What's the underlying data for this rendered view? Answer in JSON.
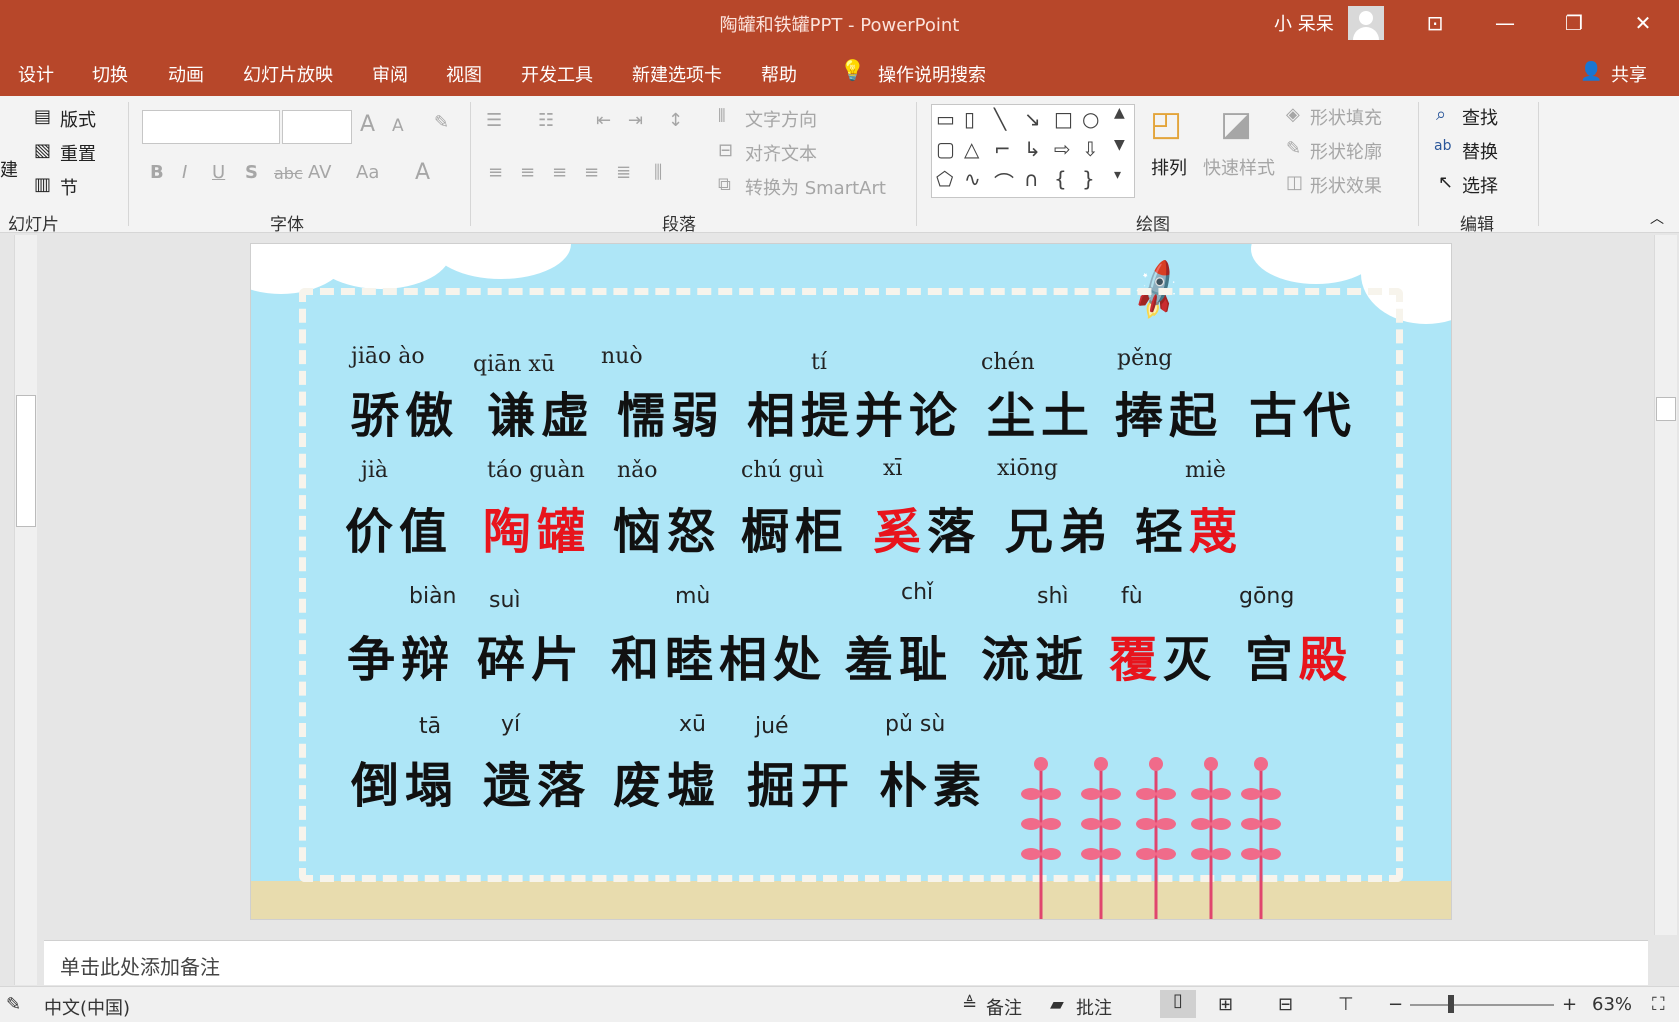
{
  "titlebar": {
    "title": "陶罐和铁罐PPT  -  PowerPoint",
    "user": "小 呆呆",
    "buttons": [
      "ribbon-display",
      "minimize",
      "restore",
      "close"
    ]
  },
  "menu": {
    "tabs": [
      "设计",
      "切换",
      "动画",
      "幻灯片放映",
      "审阅",
      "视图",
      "开发工具",
      "新建选项卡",
      "帮助"
    ],
    "search": "操作说明搜索",
    "share": "共享"
  },
  "ribbon": {
    "slides_group": {
      "layout": "版式",
      "reset": "重置",
      "section": "节",
      "new_partial": "建",
      "label": "幻灯片"
    },
    "font_group": {
      "label": "字体",
      "bold": "B",
      "italic": "I",
      "underline": "U",
      "shadow": "S",
      "strike": "abc",
      "spacing": "AV",
      "case": "Aa",
      "color": "A",
      "grow": "A",
      "shrink": "A"
    },
    "paragraph_group": {
      "label": "段落",
      "text_direction": "文字方向",
      "align_text": "对齐文本",
      "smartart": "转换为 SmartArt"
    },
    "drawing_group": {
      "label": "绘图",
      "arrange": "排列",
      "quick_styles": "快速样式",
      "fill": "形状填充",
      "outline": "形状轮廓",
      "effects": "形状效果"
    },
    "editing_group": {
      "label": "编辑",
      "find": "查找",
      "replace": "替换",
      "select": "选择"
    }
  },
  "slide": {
    "rows": [
      {
        "pinyin": [
          "jiāo  ào",
          "qiān  xū",
          "nuò",
          "tí",
          "chén",
          "pěng"
        ],
        "words": [
          {
            "pre": "骄傲",
            "red": "",
            "post": ""
          },
          {
            "pre": "谦虚",
            "red": "",
            "post": ""
          },
          {
            "pre": "懦弱",
            "red": "",
            "post": ""
          },
          {
            "pre": "相提并论",
            "red": "",
            "post": ""
          },
          {
            "pre": "尘土",
            "red": "",
            "post": ""
          },
          {
            "pre": "捧起",
            "red": "",
            "post": ""
          },
          {
            "pre": "古代",
            "red": "",
            "post": ""
          }
        ]
      },
      {
        "pinyin": [
          "jià",
          "táo guàn",
          "nǎo",
          "chú  guì",
          "xī",
          "xiōng",
          "miè"
        ],
        "words": [
          {
            "pre": "价值",
            "red": "",
            "post": ""
          },
          {
            "pre": "",
            "red": "陶罐",
            "post": ""
          },
          {
            "pre": "恼怒",
            "red": "",
            "post": ""
          },
          {
            "pre": "橱柜",
            "red": "",
            "post": ""
          },
          {
            "pre": "",
            "red": "奚",
            "post": "落"
          },
          {
            "pre": "兄弟",
            "red": "",
            "post": ""
          },
          {
            "pre": "轻",
            "red": "蔑",
            "post": ""
          }
        ]
      },
      {
        "pinyin": [
          "biàn",
          "suì",
          "mù",
          "chǐ",
          "shì",
          "fù",
          "gōng"
        ],
        "words": [
          {
            "pre": "争辩",
            "red": "",
            "post": ""
          },
          {
            "pre": "碎片",
            "red": "",
            "post": ""
          },
          {
            "pre": "和睦相处",
            "red": "",
            "post": ""
          },
          {
            "pre": "羞耻",
            "red": "",
            "post": ""
          },
          {
            "pre": "流逝",
            "red": "",
            "post": ""
          },
          {
            "pre": "",
            "red": "覆",
            "post": "灭"
          },
          {
            "pre": "宫",
            "red": "殿",
            "post": ""
          }
        ]
      },
      {
        "pinyin": [
          "tā",
          "yí",
          "xū",
          "jué",
          "pǔ   sù"
        ],
        "words": [
          {
            "pre": "倒塌",
            "red": "",
            "post": ""
          },
          {
            "pre": "遗落",
            "red": "",
            "post": ""
          },
          {
            "pre": "废墟",
            "red": "",
            "post": ""
          },
          {
            "pre": "掘开",
            "red": "",
            "post": ""
          },
          {
            "pre": "朴素",
            "red": "",
            "post": ""
          }
        ]
      }
    ]
  },
  "notes": {
    "placeholder": "单击此处添加备注"
  },
  "status": {
    "language": "中文(中国)",
    "notes_btn": "备注",
    "comments_btn": "批注",
    "zoom": "63%"
  },
  "colors": {
    "accent": "#b7472a",
    "slide_bg": "#aee6f7",
    "highlight": "#e8141c"
  }
}
